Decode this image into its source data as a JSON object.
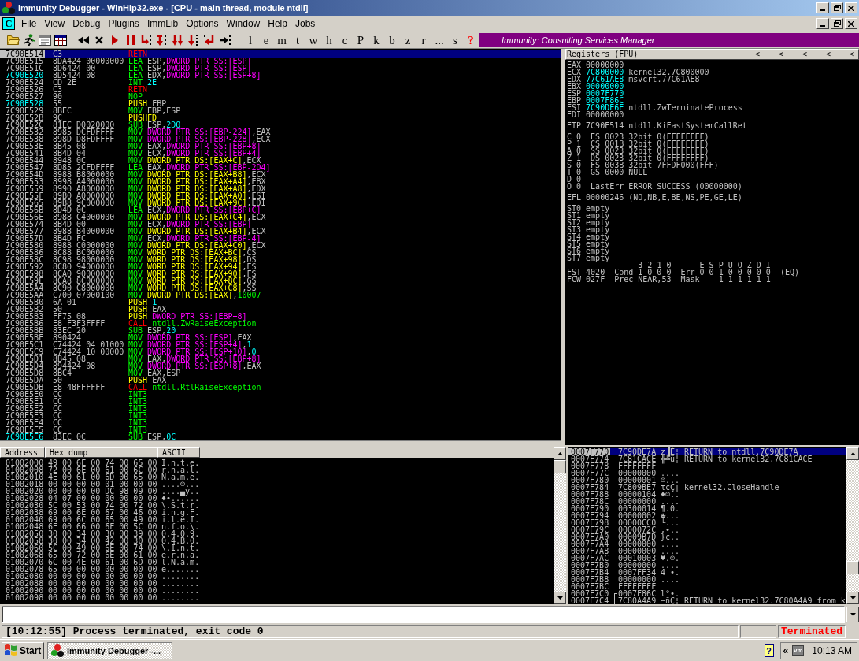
{
  "window": {
    "title": "Immunity Debugger - WinHlp32.exe - [CPU - main thread, module ntdll]"
  },
  "menu": {
    "child_badge": "C",
    "items": [
      "File",
      "View",
      "Debug",
      "Plugins",
      "ImmLib",
      "Options",
      "Window",
      "Help",
      "Jobs"
    ]
  },
  "toolbar": {
    "commands": [
      {
        "label": "l",
        "kind": "plain"
      },
      {
        "label": "e",
        "kind": "plain"
      },
      {
        "label": "m",
        "kind": "plain"
      },
      {
        "label": "t",
        "kind": "plain"
      },
      {
        "label": "w",
        "kind": "plain"
      },
      {
        "label": "h",
        "kind": "plain"
      },
      {
        "label": "c",
        "kind": "plain"
      },
      {
        "label": "P",
        "kind": "plain"
      },
      {
        "label": "k",
        "kind": "plain"
      },
      {
        "label": "b",
        "kind": "plain"
      },
      {
        "label": "z",
        "kind": "plain"
      },
      {
        "label": "r",
        "kind": "plain"
      },
      {
        "label": "...",
        "kind": "plain"
      },
      {
        "label": "s",
        "kind": "plain"
      },
      {
        "label": "?",
        "kind": "help"
      }
    ],
    "banner": "Immunity: Consulting Services Manager"
  },
  "disassembly": {
    "rows": [
      {
        "address": "7C90E514",
        "hex": "C3",
        "mnemonic": "RETN",
        "kind": "flow",
        "target": false,
        "selected": true
      },
      {
        "address": "7C90E515",
        "hex": "8DA424 00000000",
        "mnemonic": "LEA",
        "kind": "plain",
        "operands": [
          {
            "kind": "reg",
            "text": "ESP,"
          },
          {
            "kind": "stack",
            "text": "DWORD PTR SS:[ESP]"
          }
        ],
        "target": false,
        "selected": false
      },
      {
        "address": "7C90E51C",
        "hex": "8D6424 00",
        "mnemonic": "LEA",
        "kind": "plain",
        "operands": [
          {
            "kind": "reg",
            "text": "ESP,"
          },
          {
            "kind": "stack",
            "text": "DWORD PTR SS:[ESP]"
          }
        ],
        "target": false,
        "selected": false
      },
      {
        "address": "7C90E520",
        "hex": "8D5424 08",
        "mnemonic": "LEA",
        "kind": "plain",
        "operands": [
          {
            "kind": "reg",
            "text": "EDX,"
          },
          {
            "kind": "stack",
            "text": "DWORD PTR SS:[ESP+8]"
          }
        ],
        "target": true,
        "selected": false
      },
      {
        "address": "7C90E524",
        "hex": "CD 2E",
        "mnemonic": "INT",
        "kind": "plain",
        "operands": [
          {
            "kind": "const",
            "text": "2E"
          }
        ],
        "target": false,
        "selected": false
      },
      {
        "address": "7C90E526",
        "hex": "C3",
        "mnemonic": "RETN",
        "kind": "flow",
        "target": false,
        "selected": false
      },
      {
        "address": "7C90E527",
        "hex": "90",
        "mnemonic": "NOP",
        "kind": "plain",
        "target": false,
        "selected": false
      },
      {
        "address": "7C90E528",
        "hex": "55",
        "mnemonic": "PUSH",
        "kind": "stack",
        "operands": [
          {
            "kind": "reg",
            "text": "EBP"
          }
        ],
        "target": true,
        "selected": false
      },
      {
        "address": "7C90E529",
        "hex": "8BEC",
        "mnemonic": "MOV",
        "kind": "plain",
        "operands": [
          {
            "kind": "reg",
            "text": "EBP,ESP"
          }
        ],
        "target": false,
        "selected": false
      },
      {
        "address": "7C90E52B",
        "hex": "9C",
        "mnemonic": "PUSHFD",
        "kind": "stack",
        "target": false,
        "selected": false
      },
      {
        "address": "7C90E52C",
        "hex": "81EC D0020000",
        "mnemonic": "SUB",
        "kind": "plain",
        "operands": [
          {
            "kind": "reg",
            "text": "ESP,"
          },
          {
            "kind": "const",
            "text": "2D0"
          }
        ],
        "target": false,
        "selected": false
      },
      {
        "address": "7C90E532",
        "hex": "8985 DCFDFFFF",
        "mnemonic": "MOV",
        "kind": "plain",
        "operands": [
          {
            "kind": "stack",
            "text": "DWORD PTR SS:[EBP-224]"
          },
          {
            "kind": "reg",
            "text": ",EAX"
          }
        ],
        "target": false,
        "selected": false
      },
      {
        "address": "7C90E538",
        "hex": "898D D8FDFFFF",
        "mnemonic": "MOV",
        "kind": "plain",
        "operands": [
          {
            "kind": "stack",
            "text": "DWORD PTR SS:[EBP-228]"
          },
          {
            "kind": "reg",
            "text": ",ECX"
          }
        ],
        "target": false,
        "selected": false
      },
      {
        "address": "7C90E53E",
        "hex": "8B45 08",
        "mnemonic": "MOV",
        "kind": "plain",
        "operands": [
          {
            "kind": "reg",
            "text": "EAX,"
          },
          {
            "kind": "stack",
            "text": "DWORD PTR SS:[EBP+8]"
          }
        ],
        "target": false,
        "selected": false
      },
      {
        "address": "7C90E541",
        "hex": "8B4D 04",
        "mnemonic": "MOV",
        "kind": "plain",
        "operands": [
          {
            "kind": "reg",
            "text": "ECX,"
          },
          {
            "kind": "stack",
            "text": "DWORD PTR SS:[EBP+4]"
          }
        ],
        "target": false,
        "selected": false
      },
      {
        "address": "7C90E544",
        "hex": "8948 0C",
        "mnemonic": "MOV",
        "kind": "plain",
        "operands": [
          {
            "kind": "mem",
            "text": "DWORD PTR DS:[EAX+C]"
          },
          {
            "kind": "reg",
            "text": ",ECX"
          }
        ],
        "target": false,
        "selected": false
      },
      {
        "address": "7C90E547",
        "hex": "8D85 2CFDFFFF",
        "mnemonic": "LEA",
        "kind": "plain",
        "operands": [
          {
            "kind": "reg",
            "text": "EAX,"
          },
          {
            "kind": "stack",
            "text": "DWORD PTR SS:[EBP-2D4]"
          }
        ],
        "target": false,
        "selected": false
      },
      {
        "address": "7C90E54D",
        "hex": "8988 B8000000",
        "mnemonic": "MOV",
        "kind": "plain",
        "operands": [
          {
            "kind": "mem",
            "text": "DWORD PTR DS:[EAX+B8]"
          },
          {
            "kind": "reg",
            "text": ",ECX"
          }
        ],
        "target": false,
        "selected": false
      },
      {
        "address": "7C90E553",
        "hex": "8998 A4000000",
        "mnemonic": "MOV",
        "kind": "plain",
        "operands": [
          {
            "kind": "mem",
            "text": "DWORD PTR DS:[EAX+A4]"
          },
          {
            "kind": "reg",
            "text": ",EBX"
          }
        ],
        "target": false,
        "selected": false
      },
      {
        "address": "7C90E559",
        "hex": "8990 A8000000",
        "mnemonic": "MOV",
        "kind": "plain",
        "operands": [
          {
            "kind": "mem",
            "text": "DWORD PTR DS:[EAX+A8]"
          },
          {
            "kind": "reg",
            "text": ",EDX"
          }
        ],
        "target": false,
        "selected": false
      },
      {
        "address": "7C90E55F",
        "hex": "89B0 A0000000",
        "mnemonic": "MOV",
        "kind": "plain",
        "operands": [
          {
            "kind": "mem",
            "text": "DWORD PTR DS:[EAX+A0]"
          },
          {
            "kind": "reg",
            "text": ",ESI"
          }
        ],
        "target": false,
        "selected": false
      },
      {
        "address": "7C90E565",
        "hex": "89B8 9C000000",
        "mnemonic": "MOV",
        "kind": "plain",
        "operands": [
          {
            "kind": "mem",
            "text": "DWORD PTR DS:[EAX+9C]"
          },
          {
            "kind": "reg",
            "text": ",EDI"
          }
        ],
        "target": false,
        "selected": false
      },
      {
        "address": "7C90E56B",
        "hex": "8D4D 0C",
        "mnemonic": "LEA",
        "kind": "plain",
        "operands": [
          {
            "kind": "reg",
            "text": "ECX,"
          },
          {
            "kind": "stack",
            "text": "DWORD PTR SS:[EBP+C]"
          }
        ],
        "target": false,
        "selected": false
      },
      {
        "address": "7C90E56E",
        "hex": "8988 C4000000",
        "mnemonic": "MOV",
        "kind": "plain",
        "operands": [
          {
            "kind": "mem",
            "text": "DWORD PTR DS:[EAX+C4]"
          },
          {
            "kind": "reg",
            "text": ",ECX"
          }
        ],
        "target": false,
        "selected": false
      },
      {
        "address": "7C90E574",
        "hex": "8B4D 00",
        "mnemonic": "MOV",
        "kind": "plain",
        "operands": [
          {
            "kind": "reg",
            "text": "ECX,"
          },
          {
            "kind": "stack",
            "text": "DWORD PTR SS:[EBP]"
          }
        ],
        "target": false,
        "selected": false
      },
      {
        "address": "7C90E577",
        "hex": "8988 B4000000",
        "mnemonic": "MOV",
        "kind": "plain",
        "operands": [
          {
            "kind": "mem",
            "text": "DWORD PTR DS:[EAX+B4]"
          },
          {
            "kind": "reg",
            "text": ",ECX"
          }
        ],
        "target": false,
        "selected": false
      },
      {
        "address": "7C90E57D",
        "hex": "8B4D FC",
        "mnemonic": "MOV",
        "kind": "plain",
        "operands": [
          {
            "kind": "reg",
            "text": "ECX,"
          },
          {
            "kind": "stack",
            "text": "DWORD PTR SS:[EBP-4]"
          }
        ],
        "target": false,
        "selected": false
      },
      {
        "address": "7C90E580",
        "hex": "8988 C0000000",
        "mnemonic": "MOV",
        "kind": "plain",
        "operands": [
          {
            "kind": "mem",
            "text": "DWORD PTR DS:[EAX+C0]"
          },
          {
            "kind": "reg",
            "text": ",ECX"
          }
        ],
        "target": false,
        "selected": false
      },
      {
        "address": "7C90E586",
        "hex": "8C88 BC000000",
        "mnemonic": "MOV",
        "kind": "plain",
        "operands": [
          {
            "kind": "mem",
            "text": "WORD PTR DS:[EAX+BC]"
          },
          {
            "kind": "reg",
            "text": ",CS"
          }
        ],
        "target": false,
        "selected": false
      },
      {
        "address": "7C90E58C",
        "hex": "8C98 98000000",
        "mnemonic": "MOV",
        "kind": "plain",
        "operands": [
          {
            "kind": "mem",
            "text": "WORD PTR DS:[EAX+98]"
          },
          {
            "kind": "reg",
            "text": ",DS"
          }
        ],
        "target": false,
        "selected": false
      },
      {
        "address": "7C90E592",
        "hex": "8C80 94000000",
        "mnemonic": "MOV",
        "kind": "plain",
        "operands": [
          {
            "kind": "mem",
            "text": "WORD PTR DS:[EAX+94]"
          },
          {
            "kind": "reg",
            "text": ",ES"
          }
        ],
        "target": false,
        "selected": false
      },
      {
        "address": "7C90E598",
        "hex": "8CA0 90000000",
        "mnemonic": "MOV",
        "kind": "plain",
        "operands": [
          {
            "kind": "mem",
            "text": "WORD PTR DS:[EAX+90]"
          },
          {
            "kind": "reg",
            "text": ",FS"
          }
        ],
        "target": false,
        "selected": false
      },
      {
        "address": "7C90E59E",
        "hex": "8CA8 8C000000",
        "mnemonic": "MOV",
        "kind": "plain",
        "operands": [
          {
            "kind": "mem",
            "text": "WORD PTR DS:[EAX+8C]"
          },
          {
            "kind": "reg",
            "text": ",GS"
          }
        ],
        "target": false,
        "selected": false
      },
      {
        "address": "7C90E5A4",
        "hex": "8C90 C8000000",
        "mnemonic": "MOV",
        "kind": "plain",
        "operands": [
          {
            "kind": "mem",
            "text": "WORD PTR DS:[EAX+C8]"
          },
          {
            "kind": "reg",
            "text": ",SS"
          }
        ],
        "target": false,
        "selected": false
      },
      {
        "address": "7C90E5AA",
        "hex": "C700 07000100",
        "mnemonic": "MOV",
        "kind": "plain",
        "operands": [
          {
            "kind": "mem",
            "text": "DWORD PTR DS:[EAX]"
          },
          {
            "kind": "reg",
            "text": ","
          },
          {
            "kind": "sym",
            "text": "10007"
          }
        ],
        "target": false,
        "selected": false
      },
      {
        "address": "7C90E5B0",
        "hex": "6A 01",
        "mnemonic": "PUSH",
        "kind": "stack",
        "operands": [
          {
            "kind": "const",
            "text": "1"
          }
        ],
        "target": false,
        "selected": false
      },
      {
        "address": "7C90E5B2",
        "hex": "50",
        "mnemonic": "PUSH",
        "kind": "stack",
        "operands": [
          {
            "kind": "reg",
            "text": "EAX"
          }
        ],
        "target": false,
        "selected": false
      },
      {
        "address": "7C90E5B3",
        "hex": "FF75 08",
        "mnemonic": "PUSH",
        "kind": "stack",
        "operands": [
          {
            "kind": "stack",
            "text": "DWORD PTR SS:[EBP+8]"
          }
        ],
        "target": false,
        "selected": false
      },
      {
        "address": "7C90E5B6",
        "hex": "E8 F3F3FFFF",
        "mnemonic": "CALL",
        "kind": "flow",
        "operands": [
          {
            "kind": "sym",
            "text": "ntdll.ZwRaiseException"
          }
        ],
        "target": false,
        "selected": false
      },
      {
        "address": "7C90E5BB",
        "hex": "83EC 20",
        "mnemonic": "SUB",
        "kind": "plain",
        "operands": [
          {
            "kind": "reg",
            "text": "ESP,"
          },
          {
            "kind": "const",
            "text": "20"
          }
        ],
        "target": false,
        "selected": false
      },
      {
        "address": "7C90E5BE",
        "hex": "890424",
        "mnemonic": "MOV",
        "kind": "plain",
        "operands": [
          {
            "kind": "stack",
            "text": "DWORD PTR SS:[ESP]"
          },
          {
            "kind": "reg",
            "text": ",EAX"
          }
        ],
        "target": false,
        "selected": false
      },
      {
        "address": "7C90E5C1",
        "hex": "C74424 04 01000",
        "mnemonic": "MOV",
        "kind": "plain",
        "operands": [
          {
            "kind": "stack",
            "text": "DWORD PTR SS:[ESP+4]"
          },
          {
            "kind": "reg",
            "text": ","
          },
          {
            "kind": "const",
            "text": "1"
          }
        ],
        "target": false,
        "selected": false
      },
      {
        "address": "7C90E5C9",
        "hex": "C74424 10 00000",
        "mnemonic": "MOV",
        "kind": "plain",
        "operands": [
          {
            "kind": "stack",
            "text": "DWORD PTR SS:[ESP+10]"
          },
          {
            "kind": "reg",
            "text": ","
          },
          {
            "kind": "const",
            "text": "0"
          }
        ],
        "target": false,
        "selected": false
      },
      {
        "address": "7C90E5D1",
        "hex": "8B45 08",
        "mnemonic": "MOV",
        "kind": "plain",
        "operands": [
          {
            "kind": "reg",
            "text": "EAX,"
          },
          {
            "kind": "stack",
            "text": "DWORD PTR SS:[EBP+8]"
          }
        ],
        "target": false,
        "selected": false
      },
      {
        "address": "7C90E5D4",
        "hex": "894424 08",
        "mnemonic": "MOV",
        "kind": "plain",
        "operands": [
          {
            "kind": "stack",
            "text": "DWORD PTR SS:[ESP+8]"
          },
          {
            "kind": "reg",
            "text": ",EAX"
          }
        ],
        "target": false,
        "selected": false
      },
      {
        "address": "7C90E5D8",
        "hex": "8BC4",
        "mnemonic": "MOV",
        "kind": "plain",
        "operands": [
          {
            "kind": "reg",
            "text": "EAX,ESP"
          }
        ],
        "target": false,
        "selected": false
      },
      {
        "address": "7C90E5DA",
        "hex": "50",
        "mnemonic": "PUSH",
        "kind": "stack",
        "operands": [
          {
            "kind": "reg",
            "text": "EAX"
          }
        ],
        "target": false,
        "selected": false
      },
      {
        "address": "7C90E5DB",
        "hex": "E8 48FFFFFF",
        "mnemonic": "CALL",
        "kind": "flow",
        "operands": [
          {
            "kind": "sym",
            "text": "ntdll.RtlRaiseException"
          }
        ],
        "target": false,
        "selected": false
      },
      {
        "address": "7C90E5E0",
        "hex": "CC",
        "mnemonic": "INT3",
        "kind": "plain",
        "target": false,
        "selected": false
      },
      {
        "address": "7C90E5E1",
        "hex": "CC",
        "mnemonic": "INT3",
        "kind": "plain",
        "target": false,
        "selected": false
      },
      {
        "address": "7C90E5E2",
        "hex": "CC",
        "mnemonic": "INT3",
        "kind": "plain",
        "target": false,
        "selected": false
      },
      {
        "address": "7C90E5E3",
        "hex": "CC",
        "mnemonic": "INT3",
        "kind": "plain",
        "target": false,
        "selected": false
      },
      {
        "address": "7C90E5E4",
        "hex": "CC",
        "mnemonic": "INT3",
        "kind": "plain",
        "target": false,
        "selected": false
      },
      {
        "address": "7C90E5E5",
        "hex": "CC",
        "mnemonic": "INT3",
        "kind": "plain",
        "target": false,
        "selected": false
      },
      {
        "address": "7C90E5E6",
        "hex": "83EC 0C",
        "mnemonic": "SUB",
        "kind": "plain",
        "operands": [
          {
            "kind": "reg",
            "text": "ESP,"
          },
          {
            "kind": "const",
            "text": "0C"
          }
        ],
        "target": true,
        "selected": false
      }
    ]
  },
  "registers": {
    "title": "Registers (FPU)",
    "nav_buttons": [
      "<",
      "<",
      "<",
      "<",
      "<"
    ],
    "general": [
      {
        "name": "EAX",
        "value": "00000000",
        "changed": false
      },
      {
        "name": "ECX",
        "value": "7C800000",
        "changed": true,
        "comment": "kernel32.7C800000"
      },
      {
        "name": "EDX",
        "value": "77C61AE8",
        "changed": true,
        "comment": "msvcrt.77C61AE8"
      },
      {
        "name": "EBX",
        "value": "00000000",
        "changed": true
      },
      {
        "name": "ESP",
        "value": "0007F770",
        "changed": true
      },
      {
        "name": "EBP",
        "value": "0007F86C",
        "changed": true
      },
      {
        "name": "ESI",
        "value": "7C90DE6E",
        "changed": true,
        "comment": "ntdll.ZwTerminateProcess"
      },
      {
        "name": "EDI",
        "value": "00000000",
        "changed": false
      }
    ],
    "eip": {
      "name": "EIP",
      "value": "7C90E514",
      "comment": "ntdll.KiFastSystemCallRet"
    },
    "flags": [
      {
        "name": "C",
        "bit": "0",
        "detail": "ES 0023 32bit 0(FFFFFFFF)"
      },
      {
        "name": "P",
        "bit": "1",
        "detail": "CS 001B 32bit 0(FFFFFFFF)"
      },
      {
        "name": "A",
        "bit": "0",
        "detail": "SS 0023 32bit 0(FFFFFFFF)"
      },
      {
        "name": "Z",
        "bit": "1",
        "detail": "DS 0023 32bit 0(FFFFFFFF)"
      },
      {
        "name": "S",
        "bit": "0",
        "detail": "FS 003B 32bit 7FFDF000(FFF)"
      },
      {
        "name": "T",
        "bit": "0",
        "detail": "GS 0000 NULL"
      },
      {
        "name": "D",
        "bit": "0"
      },
      {
        "name": "O",
        "bit": "0",
        "detail": "LastErr ERROR_SUCCESS (00000000)"
      }
    ],
    "efl": {
      "name": "EFL",
      "value": "00000246",
      "comment": "(NO,NB,E,BE,NS,PE,GE,LE)"
    },
    "fpu_stack": [
      {
        "name": "ST0",
        "value": "empty"
      },
      {
        "name": "ST1",
        "value": "empty"
      },
      {
        "name": "ST2",
        "value": "empty"
      },
      {
        "name": "ST3",
        "value": "empty"
      },
      {
        "name": "ST4",
        "value": "empty"
      },
      {
        "name": "ST5",
        "value": "empty"
      },
      {
        "name": "ST6",
        "value": "empty"
      },
      {
        "name": "ST7",
        "value": "empty"
      }
    ],
    "fpu_status": {
      "cond_bits": "3 2 1 0",
      "err_bits": "E S P U O Z D I",
      "fst": {
        "name": "FST",
        "value": "4020",
        "cond": "Cond 1 0 0 0",
        "err": "Err 0 0 1 0 0 0 0 0",
        "result": "(EQ)"
      },
      "fcw": {
        "name": "FCW",
        "value": "027F",
        "prec": "Prec NEAR,53",
        "mask_label": "Mask",
        "mask": "1 1 1 1 1 1"
      }
    }
  },
  "dump": {
    "columns": [
      "Address",
      "Hex dump",
      "ASCII"
    ],
    "rows": [
      {
        "address": "01002000",
        "hex": "49 00 6E 00 74 00 65 00",
        "ascii": "I.n.t.e."
      },
      {
        "address": "01002008",
        "hex": "72 00 6E 00 61 00 6C 00",
        "ascii": "r.n.a.l."
      },
      {
        "address": "01002010",
        "hex": "4E 00 61 00 6D 00 65 00",
        "ascii": "N.a.m.e."
      },
      {
        "address": "01002018",
        "hex": "00 00 00 00 01 00 00 00",
        "ascii": "....☺..."
      },
      {
        "address": "01002020",
        "hex": "00 00 00 00 DC 98 09 00",
        "ascii": "....▄ÿ.."
      },
      {
        "address": "01002028",
        "hex": "04 07 00 00 00 00 00 00",
        "ascii": "♦•......"
      },
      {
        "address": "01002030",
        "hex": "5C 00 53 00 74 00 72 00",
        "ascii": "\\.S.t.r."
      },
      {
        "address": "01002038",
        "hex": "69 00 6E 00 67 00 46 00",
        "ascii": "i.n.g.F."
      },
      {
        "address": "01002040",
        "hex": "69 00 6C 00 65 00 49 00",
        "ascii": "i.l.e.I."
      },
      {
        "address": "01002048",
        "hex": "6E 00 66 00 6F 00 5C 00",
        "ascii": "n.f.o.\\."
      },
      {
        "address": "01002050",
        "hex": "30 00 34 00 30 00 39 00",
        "ascii": "0.4.0.9."
      },
      {
        "address": "01002058",
        "hex": "30 00 34 00 42 00 30 00",
        "ascii": "0.4.B.0."
      },
      {
        "address": "01002060",
        "hex": "5C 00 49 00 6E 00 74 00",
        "ascii": "\\.I.n.t."
      },
      {
        "address": "01002068",
        "hex": "65 00 72 00 6E 00 61 00",
        "ascii": "e.r.n.a."
      },
      {
        "address": "01002070",
        "hex": "6C 00 4E 00 61 00 6D 00",
        "ascii": "l.N.a.m."
      },
      {
        "address": "01002078",
        "hex": "65 00 00 00 00 00 00 00",
        "ascii": "e......."
      },
      {
        "address": "01002080",
        "hex": "00 00 00 00 00 00 00 00",
        "ascii": "........"
      },
      {
        "address": "01002088",
        "hex": "00 00 00 00 00 00 00 00",
        "ascii": "........"
      },
      {
        "address": "01002090",
        "hex": "00 00 00 00 00 00 00 00",
        "ascii": "........"
      },
      {
        "address": "01002098",
        "hex": "00 00 00 00 00 00 00 00",
        "ascii": "........"
      }
    ]
  },
  "stack": {
    "rows": [
      {
        "address": "0007F770",
        "value": "7C90DE7A",
        "ascii": "z▐É¦",
        "comment": "RETURN to ntdll.7C90DE7A",
        "selected": true,
        "kind": "plain"
      },
      {
        "address": "0007F774",
        "value": "7C81CACE",
        "ascii": "╬╩ü¦",
        "comment": "RETURN to kernel32.7C81CACE",
        "selected": false,
        "kind": "plain"
      },
      {
        "address": "0007F778",
        "value": "FFFFFFFF",
        "selected": false,
        "kind": "plain"
      },
      {
        "address": "0007F77C",
        "value": "00000000",
        "ascii": "....",
        "selected": false,
        "kind": "plain"
      },
      {
        "address": "0007F780",
        "value": "00000001",
        "ascii": "☺...",
        "selected": false,
        "kind": "plain"
      },
      {
        "address": "0007F784",
        "value": "7C809BE7",
        "ascii": "τ¢Ç¦",
        "comment": "kernel32.CloseHandle",
        "selected": false,
        "kind": "plain"
      },
      {
        "address": "0007F788",
        "value": "00000104",
        "ascii": "♦☺..",
        "selected": false,
        "kind": "plain"
      },
      {
        "address": "0007F78C",
        "value": "00000000",
        "ascii": "....",
        "selected": false,
        "kind": "plain"
      },
      {
        "address": "0007F790",
        "value": "00300014",
        "ascii": "¶.0.",
        "selected": false,
        "kind": "plain"
      },
      {
        "address": "0007F794",
        "value": "00000002",
        "ascii": "☻...",
        "selected": false,
        "kind": "plain"
      },
      {
        "address": "0007F798",
        "value": "00000CC0",
        "ascii": "└...",
        "selected": false,
        "kind": "plain"
      },
      {
        "address": "0007F79C",
        "value": "0000072C",
        "ascii": ",•..",
        "selected": false,
        "kind": "plain"
      },
      {
        "address": "0007F7A0",
        "value": "00009B7D",
        "ascii": "}¢..",
        "selected": false,
        "kind": "plain"
      },
      {
        "address": "0007F7A4",
        "value": "00000000",
        "ascii": "....",
        "selected": false,
        "kind": "plain"
      },
      {
        "address": "0007F7A8",
        "value": "00000000",
        "ascii": "....",
        "selected": false,
        "kind": "plain"
      },
      {
        "address": "0007F7AC",
        "value": "00010003",
        "ascii": "♥.☺.",
        "selected": false,
        "kind": "plain"
      },
      {
        "address": "0007F7B0",
        "value": "00000000",
        "ascii": "....",
        "selected": false,
        "kind": "plain"
      },
      {
        "address": "0007F7B4",
        "value": "0007FF34",
        "ascii": "4 •.",
        "selected": false,
        "kind": "plain"
      },
      {
        "address": "0007F7B8",
        "value": "00000000",
        "ascii": "....",
        "selected": false,
        "kind": "plain"
      },
      {
        "address": "0007F7BC",
        "value": "FFFFFFFF",
        "selected": false,
        "kind": "plain"
      },
      {
        "address": "0007F7C0",
        "value": "0007F86C",
        "ascii": "l°•.",
        "selected": false,
        "kind": "framestart"
      },
      {
        "address": "0007F7C4",
        "value": "7C80A4A9",
        "ascii": "⌐ñÇ¦",
        "comment": "RETURN to kernel32.7C80A4A9 from k",
        "selected": false,
        "kind": "framebody"
      }
    ]
  },
  "status_bar": {
    "message": "[10:12:55] Process terminated, exit code 0",
    "state": "Terminated"
  },
  "taskbar": {
    "start": "Start",
    "tasks": [
      {
        "label": "Immunity Debugger -...",
        "selected": true
      }
    ],
    "tray": {
      "help": "?",
      "expand": "«",
      "vm": "vm",
      "clock": "10:13 AM"
    }
  }
}
